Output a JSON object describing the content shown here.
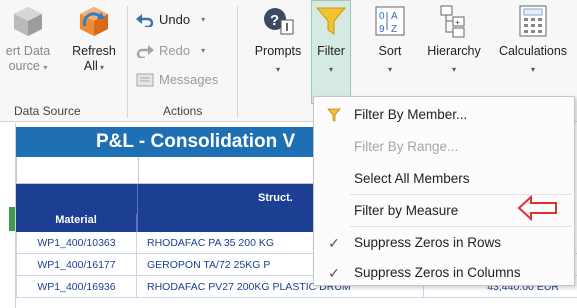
{
  "ribbon": {
    "data_source_group": {
      "insert_line1": "ert Data",
      "insert_line2": "ource",
      "refresh_line1": "Refresh",
      "refresh_line2": "All",
      "label": "Data Source"
    },
    "actions_group": {
      "undo": "Undo",
      "redo": "Redo",
      "messages": "Messages",
      "label": "Actions"
    },
    "prompts": "Prompts",
    "filter": "Filter",
    "sort": "Sort",
    "hierarchy": "Hierarchy",
    "calculations": "Calculations"
  },
  "sheet": {
    "title": "P&L - Consolidation V",
    "header_material": "Material",
    "header_struct": "Struct.",
    "rows": [
      {
        "material": "WP1_400/10363",
        "description": "RHODAFAC PA 35 200 KG",
        "amount": ""
      },
      {
        "material": "WP1_400/16177",
        "description": "GEROPON TA/72 25KG P",
        "amount": ""
      },
      {
        "material": "WP1_400/16936",
        "description": "RHODAFAC PV27 200KG PLASTIC DRUM",
        "amount": "43,440.00 EUR"
      }
    ]
  },
  "filter_menu": {
    "items": [
      {
        "label": "Filter By Member...",
        "enabled": true,
        "icon": "funnel-icon"
      },
      {
        "label": "Filter By Range...",
        "enabled": false,
        "icon": ""
      },
      {
        "label": "Select All Members",
        "enabled": true,
        "icon": ""
      },
      {
        "label": "Filter by Measure",
        "enabled": true,
        "icon": ""
      },
      {
        "label": "Suppress Zeros in Rows",
        "enabled": true,
        "icon": "checkmark-icon"
      },
      {
        "label": "Suppress Zeros in Columns",
        "enabled": true,
        "icon": "checkmark-icon"
      }
    ]
  },
  "colors": {
    "title_blue": "#1f6fb5",
    "header_navy": "#1c3f94",
    "filter_highlight": "#d5ebe1",
    "arrow_red": "#e03030"
  }
}
